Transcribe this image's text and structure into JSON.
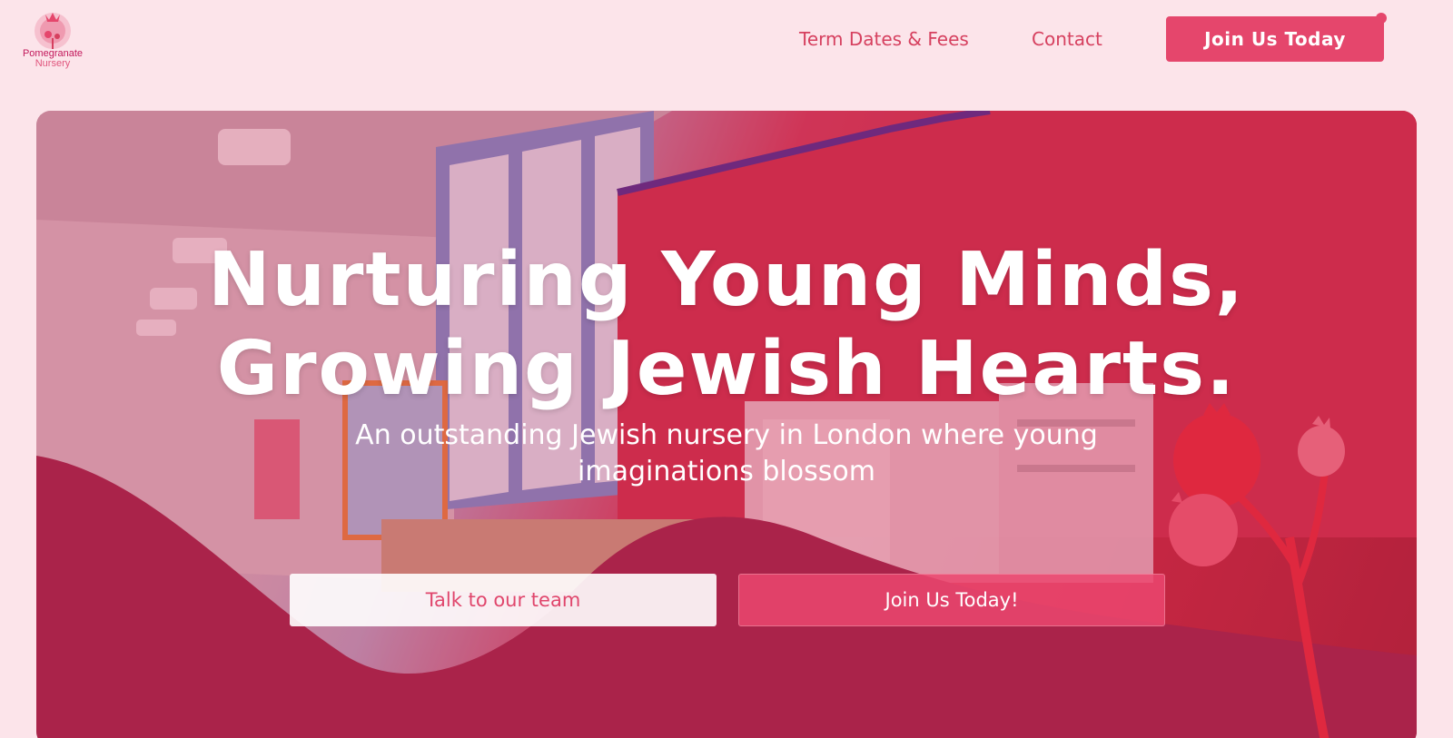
{
  "brand": {
    "logo_line1": "Pomegranate",
    "logo_line2": "Nursery",
    "accent": "#e5466c",
    "background": "#fce4ea",
    "wave": "#9e2248"
  },
  "nav": {
    "items": [
      {
        "label": "Term Dates & Fees"
      },
      {
        "label": "Contact"
      }
    ],
    "cta_label": "Join Us Today"
  },
  "hero": {
    "title_line1": "Nurturing Young Minds,",
    "title_line2": "Growing Jewish Hearts.",
    "subtitle": "An outstanding Jewish nursery in London where young imaginations blossom",
    "buttons": {
      "talk_label": "Talk to our team",
      "join_label": "Join Us Today!"
    },
    "decorations": [
      "pomegranate-branch-icon"
    ]
  }
}
